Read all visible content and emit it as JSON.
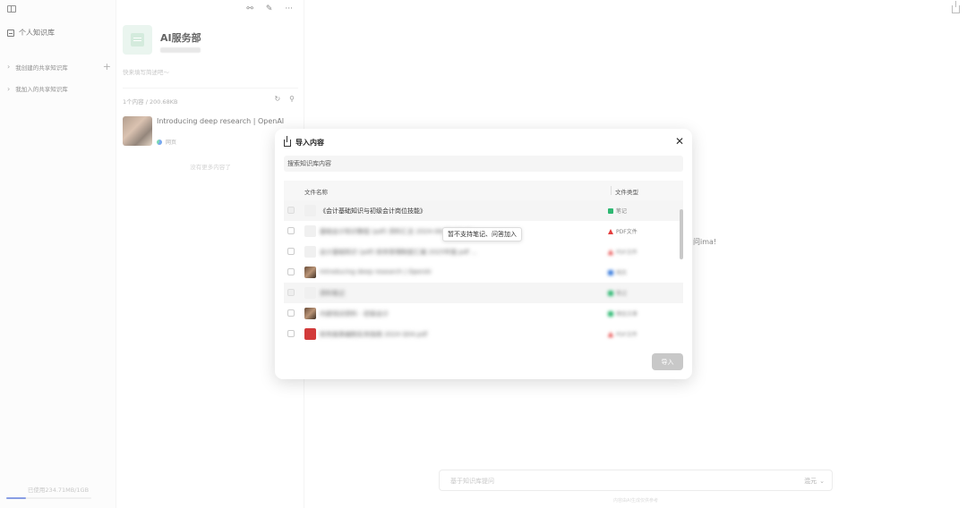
{
  "sidebar": {
    "personal_kb": "个人知识库",
    "created_shared": "我创建的共享知识库",
    "joined_shared": "我加入的共享知识库",
    "usage": "已使用234.71MB/1GB",
    "usage_fraction": 0.23
  },
  "panel": {
    "kb_title": "AI服务部",
    "kb_desc": "快来填写简述吧～",
    "stats": "1个内容 / 200.68KB",
    "item_title": "Introducing deep research | OpenAI",
    "item_type": "网页",
    "no_more": "没有更多内容了"
  },
  "main": {
    "bg_text": "问ima!",
    "chat_placeholder": "基于知识库提问",
    "model_label": "混元",
    "footer_note": "内容由AI生成仅供参考"
  },
  "modal": {
    "title": "导入内容",
    "search_placeholder": "搜索知识库内容",
    "col_name": "文件名称",
    "col_type": "文件类型",
    "tooltip": "暂不支持笔记、问答加入",
    "import_label": "导入",
    "rows": [
      {
        "name": "《会计基础知识与初级会计岗位技能》",
        "type": "笔记",
        "icon": "note",
        "thumb": "light",
        "disabled": true
      },
      {
        "name": "基础会计知识教程 (pdf) 资料汇总 2024-08-20 16:41 ...",
        "type": "PDF文件",
        "icon": "pdf",
        "thumb": "light",
        "disabled": false
      },
      {
        "name": "会计基础知识 (pdf) 财务管理制度汇编 2025年版.pdf ...",
        "type": "PDF文件",
        "icon": "pdf",
        "thumb": "light",
        "disabled": false
      },
      {
        "name": "Introducing deep research | OpenAI",
        "type": "网页",
        "icon": "web",
        "thumb": "photo",
        "disabled": false
      },
      {
        "name": "资料笔记",
        "type": "笔记",
        "icon": "note",
        "thumb": "light",
        "disabled": true
      },
      {
        "name": "内部培训资料 - 初级会计",
        "type": "微信文章",
        "icon": "note",
        "thumb": "photo",
        "disabled": false
      },
      {
        "name": "财务报表编制实务指南 2024 Q04.pdf",
        "type": "PDF文件",
        "icon": "pdf",
        "thumb": "red",
        "disabled": false
      }
    ]
  }
}
